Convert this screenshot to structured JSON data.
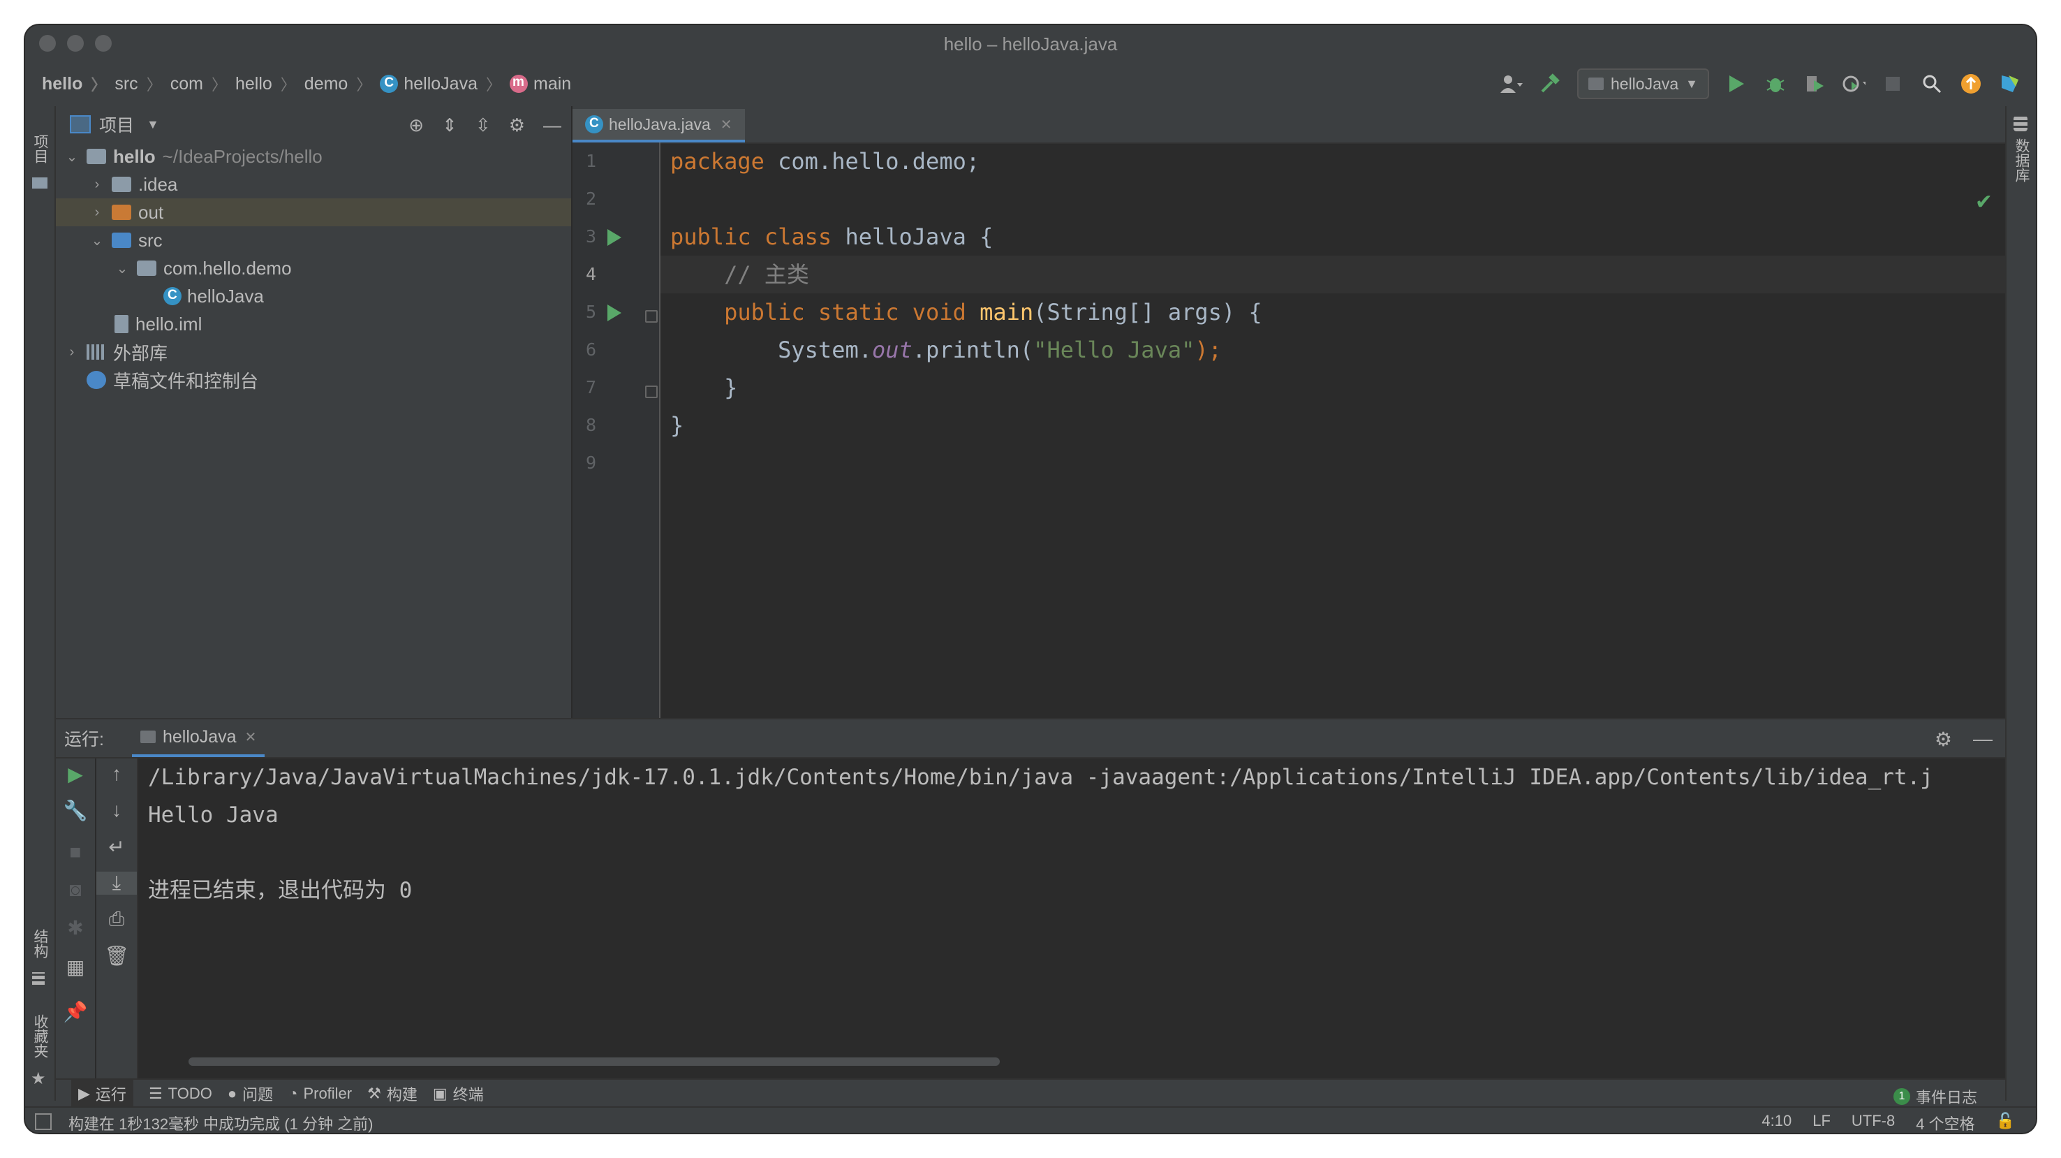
{
  "window": {
    "title": "hello – helloJava.java"
  },
  "breadcrumbs": [
    "hello",
    "src",
    "com",
    "hello",
    "demo",
    "helloJava",
    "main"
  ],
  "toolbar": {
    "run_config": "helloJava"
  },
  "left_strip": {
    "project_label": "项目",
    "structure_label": "结构",
    "favorites_label": "收藏夹"
  },
  "right_strip": {
    "database_label": "数据库"
  },
  "project_panel": {
    "title": "项目",
    "tree": [
      {
        "label": "hello",
        "extra": "~/IdeaProjects/hello"
      },
      {
        "label": ".idea"
      },
      {
        "label": "out"
      },
      {
        "label": "src"
      },
      {
        "label": "com.hello.demo"
      },
      {
        "label": "helloJava"
      },
      {
        "label": "hello.iml"
      },
      {
        "label": "外部库"
      },
      {
        "label": "草稿文件和控制台"
      }
    ]
  },
  "editor": {
    "tab": "helloJava.java",
    "line_numbers": [
      "1",
      "2",
      "3",
      "4",
      "5",
      "6",
      "7",
      "8",
      "9"
    ],
    "code": {
      "l1_kw": "package",
      "l1_rest": " com.hello.demo;",
      "l3_kw1": "public",
      "l3_kw2": "class",
      "l3_name": " helloJava {",
      "l4_comment": "// 主类",
      "l5_kw1": "public",
      "l5_kw2": "static",
      "l5_kw3": "void",
      "l5_fn": "main",
      "l5_rest": "(String[] args) {",
      "l6_a": "System.",
      "l6_field": "out",
      "l6_b": ".println(",
      "l6_str": "\"Hello Java\"",
      "l6_c": ");",
      "l7": "}",
      "l8": "}"
    }
  },
  "run_panel": {
    "label": "运行:",
    "tab": "helloJava",
    "console": [
      "/Library/Java/JavaVirtualMachines/jdk-17.0.1.jdk/Contents/Home/bin/java -javaagent:/Applications/IntelliJ IDEA.app/Contents/lib/idea_rt.j",
      "Hello Java",
      "",
      "进程已结束，退出代码为 0"
    ]
  },
  "tool_tabs": {
    "run": "运行",
    "todo": "TODO",
    "problems": "问题",
    "profiler": "Profiler",
    "build": "构建",
    "terminal": "终端",
    "event_log": "事件日志",
    "event_count": "1"
  },
  "status": {
    "message": "构建在 1秒132毫秒 中成功完成 (1 分钟 之前)",
    "position": "4:10",
    "line_sep": "LF",
    "encoding": "UTF-8",
    "indent": "4 个空格"
  },
  "colors": {
    "keyword": "#cc7832",
    "function": "#ffc66d",
    "string": "#6a8759",
    "comment": "#808080",
    "field": "#9876aa",
    "run_green": "#59a869",
    "accent": "#4a88c7"
  }
}
